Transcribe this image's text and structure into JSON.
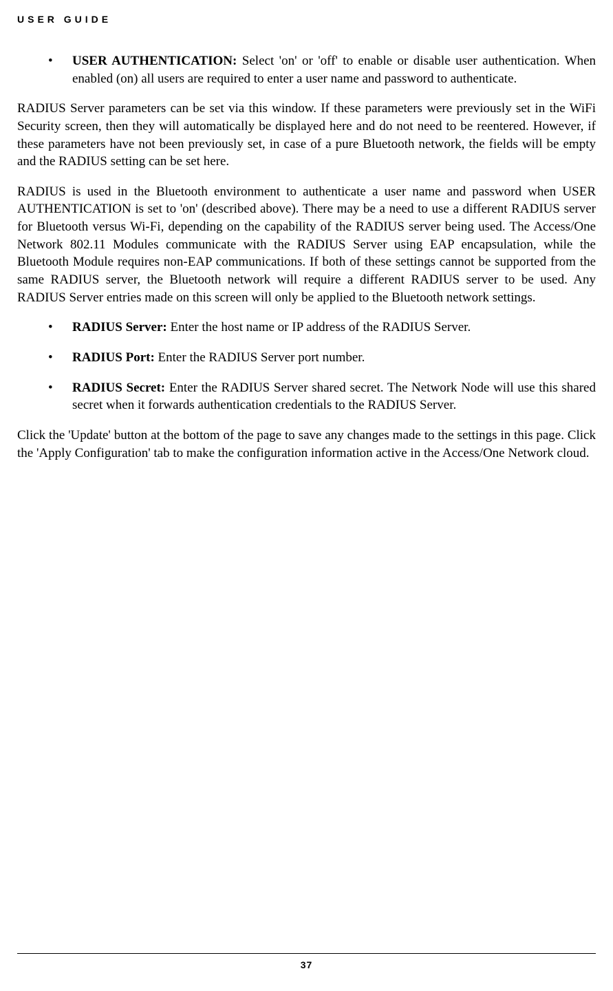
{
  "header": "USER GUIDE",
  "bullets1": [
    {
      "label": "USER AUTHENTICATION:",
      "text": " Select 'on' or 'off' to enable or disable user authentication. When enabled (on) all users are required to enter a user name and password to authenticate."
    }
  ],
  "para1": "RADIUS Server parameters can be set via this window. If these parameters were previously set in the WiFi Security screen, then they will automatically be displayed here and do not need to be reentered. However, if these parameters have not been previously set, in case of a pure Bluetooth network, the fields will be empty and the RADIUS setting can be set here.",
  "para2": "RADIUS is used in the Bluetooth environment to authenticate a user name and password when USER AUTHENTICATION is set to 'on' (described above). There may be a need to use a different RADIUS server for Bluetooth versus Wi-Fi, depending on the capability of the RADIUS server being used. The Access/One Network 802.11 Modules communicate with the RADIUS Server using EAP encapsulation, while the Bluetooth Module requires non-EAP communications. If both of these settings cannot be supported from the same RADIUS server, the Bluetooth network will require a different RADIUS server to be used. Any RADIUS Server entries made on this screen will only be applied to the Bluetooth network settings.",
  "bullets2": [
    {
      "label": "RADIUS Server:",
      "text": " Enter the host name or IP address of the RADIUS Server."
    },
    {
      "label": "RADIUS Port:",
      "text": " Enter the RADIUS Server port number."
    },
    {
      "label": "RADIUS Secret:",
      "text": " Enter the RADIUS Server shared secret. The Network Node will use this shared secret when it forwards authentication credentials to the RADIUS Server."
    }
  ],
  "para3": "Click the 'Update' button at the bottom of the page to save any changes made to the settings in this page. Click the 'Apply Configuration' tab to make the configuration information active in the Access/One Network cloud.",
  "pageNumber": "37"
}
